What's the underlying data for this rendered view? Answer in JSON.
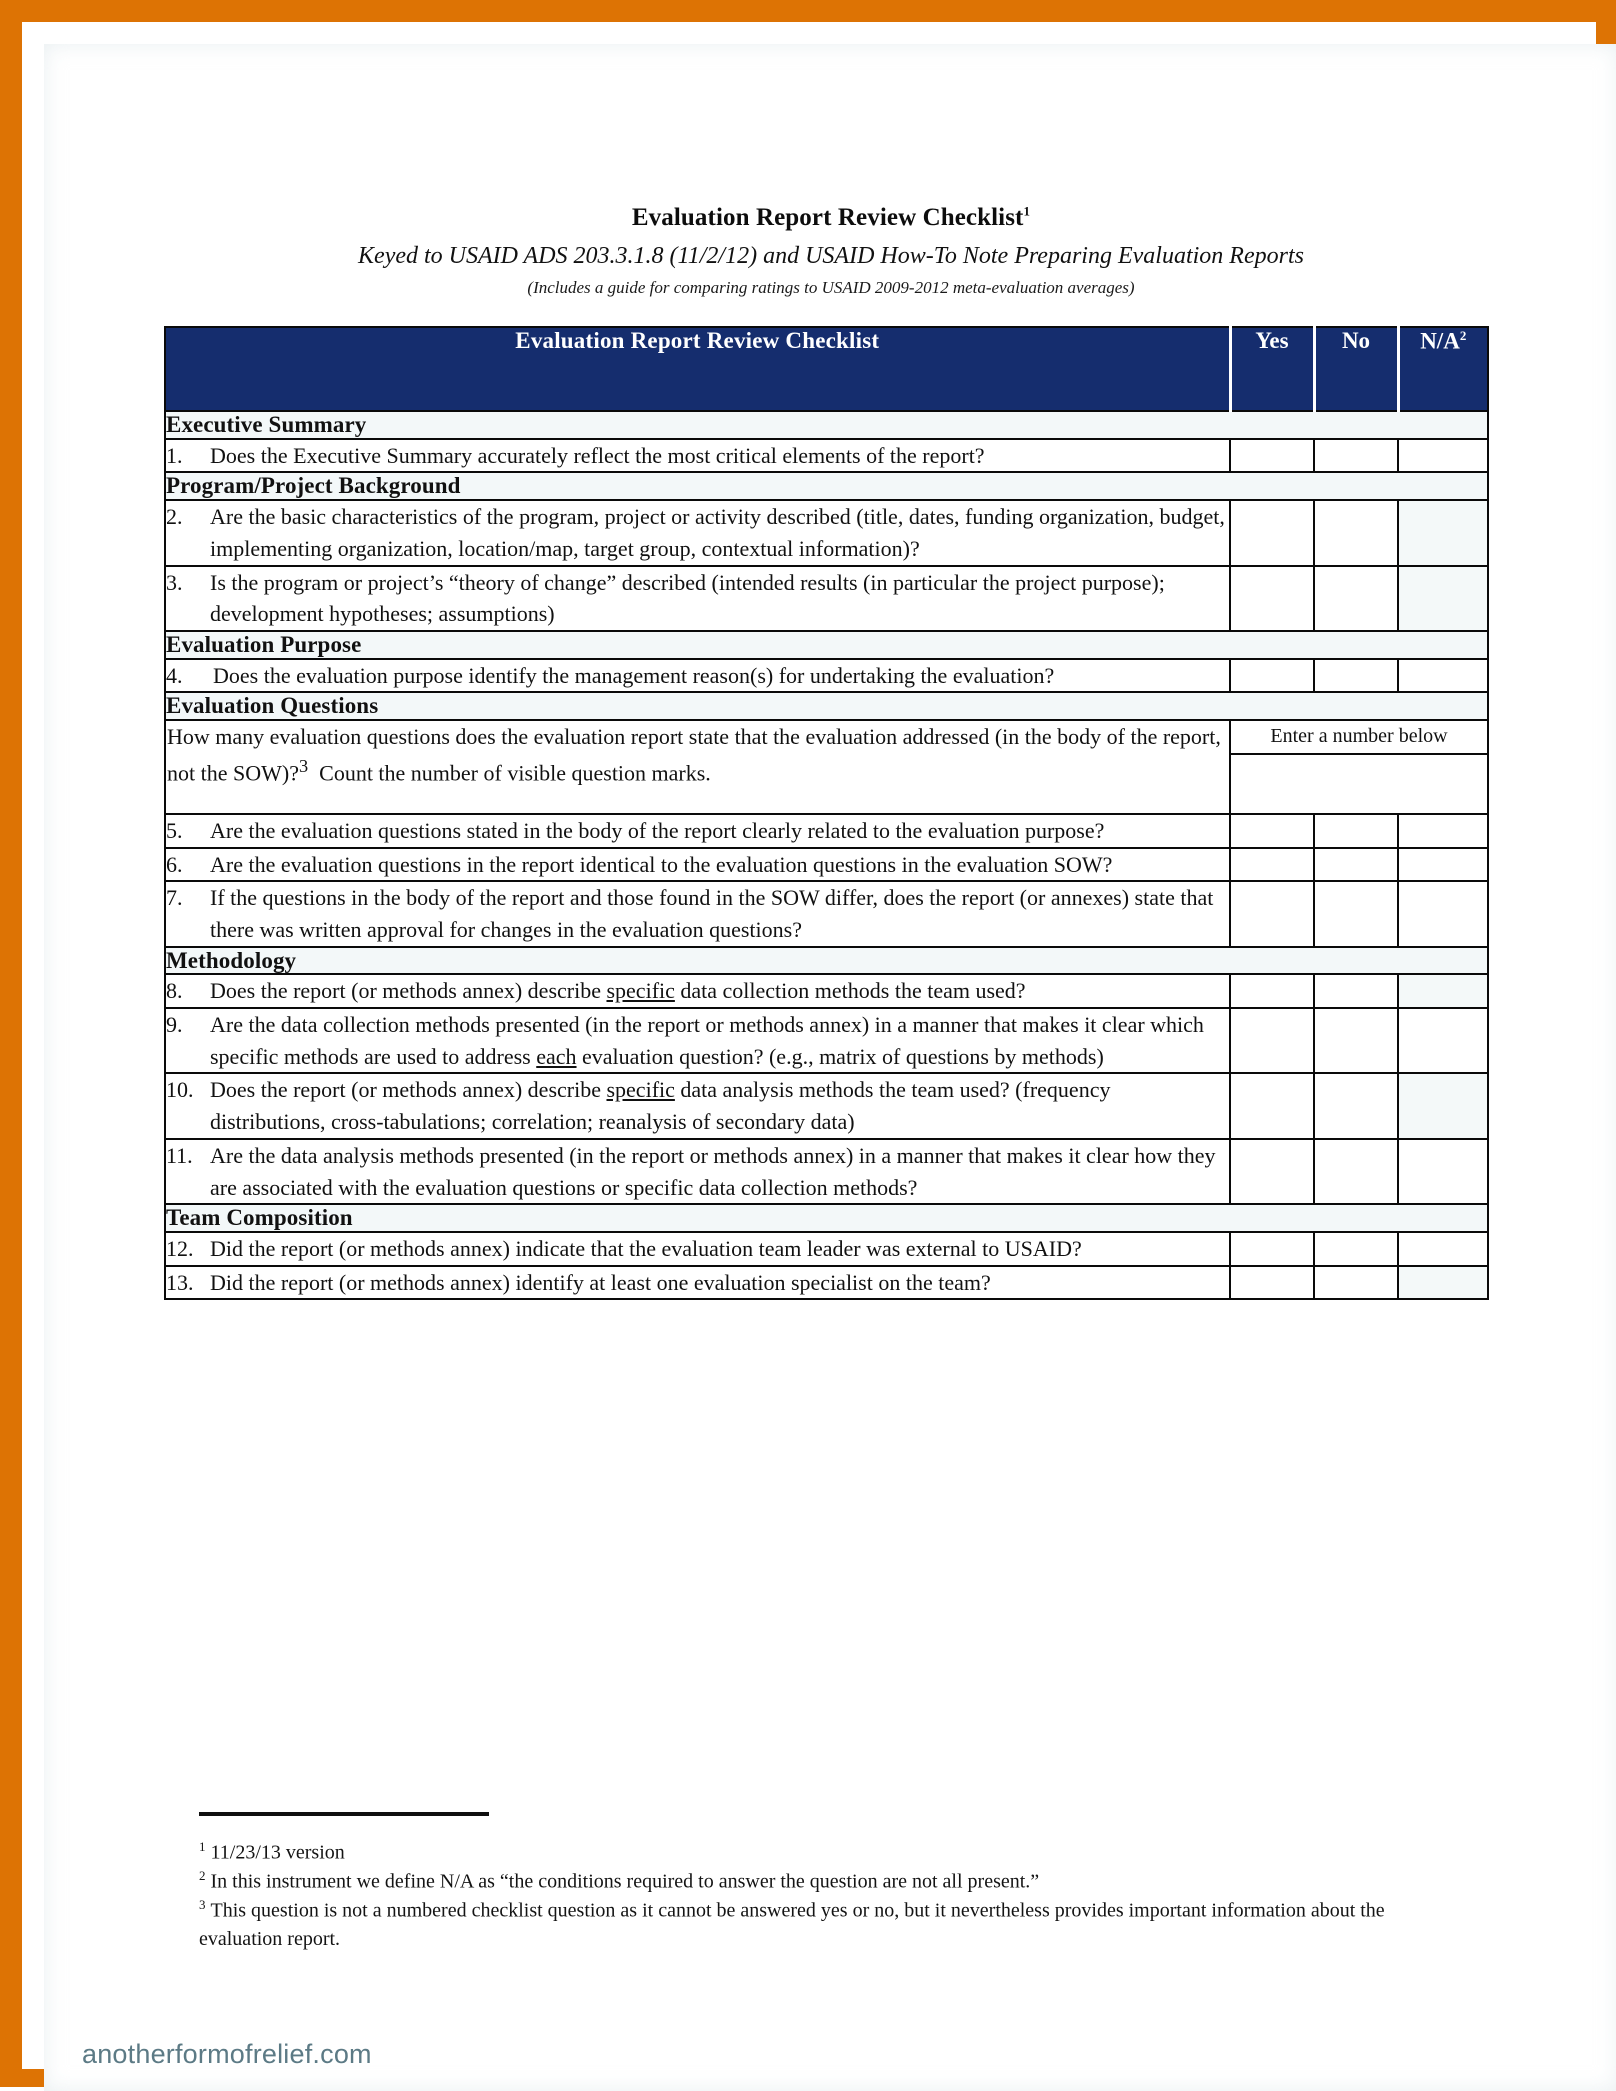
{
  "page": {
    "frame_color": "#dd7304",
    "background": "#ffffff"
  },
  "header": {
    "title": "Evaluation Report Review Checklist",
    "title_footnote_marker": "1",
    "subtitle": "Keyed to USAID ADS 203.3.1.8 (11/2/12) and USAID How-To Note Preparing Evaluation Reports",
    "subsubtitle": "(Includes a guide for comparing ratings to USAID 2009-2012 meta-evaluation averages)"
  },
  "table": {
    "accent_color": "#152d6e",
    "columns": {
      "main": "Evaluation Report Review Checklist",
      "yes": "Yes",
      "no": "No",
      "na": "N/A",
      "na_footnote_marker": "2"
    },
    "sections": [
      {
        "title": "Executive Summary"
      },
      {
        "title": "Program/Project Background"
      },
      {
        "title": "Evaluation Purpose"
      },
      {
        "title": "Evaluation Questions"
      },
      {
        "title": "Methodology"
      },
      {
        "title": "Team Composition"
      }
    ],
    "rows": {
      "q1_num": "1.",
      "q1_text": "Does the Executive Summary accurately reflect the most critical elements of the report?",
      "q2_num": "2.",
      "q2_text": "Are the basic characteristics of the program, project or activity described (title, dates, funding organization, budget, implementing organization, location/map, target group, contextual information)?",
      "q3_num": "3.",
      "q3_text_a": "Is the program or project’s “theory of change” described (intended results (in particular the project purpose); development hypotheses; assumptions)",
      "q4_num": "4.",
      "q4_text": "Does the evaluation purpose identify the management reason(s) for undertaking the evaluation?",
      "count_question_a": "How many evaluation questions does the evaluation report state that the evaluation addressed (in the body of the report, not the SOW)?",
      "count_question_marker": "3",
      "count_question_b": "Count the number of visible question marks.",
      "count_answer_label": "Enter a number below",
      "q5_num": "5.",
      "q5_text": "Are the evaluation questions stated in the body of the report clearly related to the evaluation purpose?",
      "q6_num": "6.",
      "q6_text": "Are the evaluation questions in the report identical to the evaluation questions in the evaluation SOW?",
      "q7_num": "7.",
      "q7_text": "If the questions in the body of the report and those found in the SOW differ, does the report (or annexes) state that there was written approval for changes in the evaluation questions?",
      "q8_num": "8.",
      "q8_text_a": "Does the report (or methods annex) describe ",
      "q8_emph": "specific",
      "q8_text_b": " data collection methods the team used?",
      "q9_num": "9.",
      "q9_text_a": "Are the data collection methods presented (in the report or methods annex) in a manner that makes it clear which specific methods are used to address ",
      "q9_emph": "each",
      "q9_text_b": " evaluation question?  (e.g., matrix of questions by methods)",
      "q10_num": "10.",
      "q10_text_a": "Does the report (or methods annex) describe ",
      "q10_emph": "specific",
      "q10_text_b": " data analysis methods the team used? (frequency distributions, cross-tabulations; correlation; reanalysis of secondary data)",
      "q11_num": "11.",
      "q11_text": "Are the data analysis methods presented (in the report or methods annex) in a manner that makes it clear how they are associated with the evaluation questions or specific data collection methods?",
      "q12_num": "12.",
      "q12_text": "Did the report (or methods annex) indicate that the evaluation team leader was external to USAID?",
      "q13_num": "13.",
      "q13_text": "Did the report (or methods annex) identify at least one evaluation specialist on the team?"
    }
  },
  "footnotes": {
    "fn1_marker": "1",
    "fn1_text": "11/23/13 version",
    "fn2_marker": "2",
    "fn2_text": "In this instrument we define N/A as “the conditions required to answer the question are not all present.”",
    "fn3_marker": "3",
    "fn3_text": "This question is not a numbered checklist question as it cannot be answered yes or no, but it nevertheless provides important information about the evaluation report."
  },
  "watermark": {
    "text": "anotherformofrelief.com",
    "color": "#5c7a85"
  }
}
